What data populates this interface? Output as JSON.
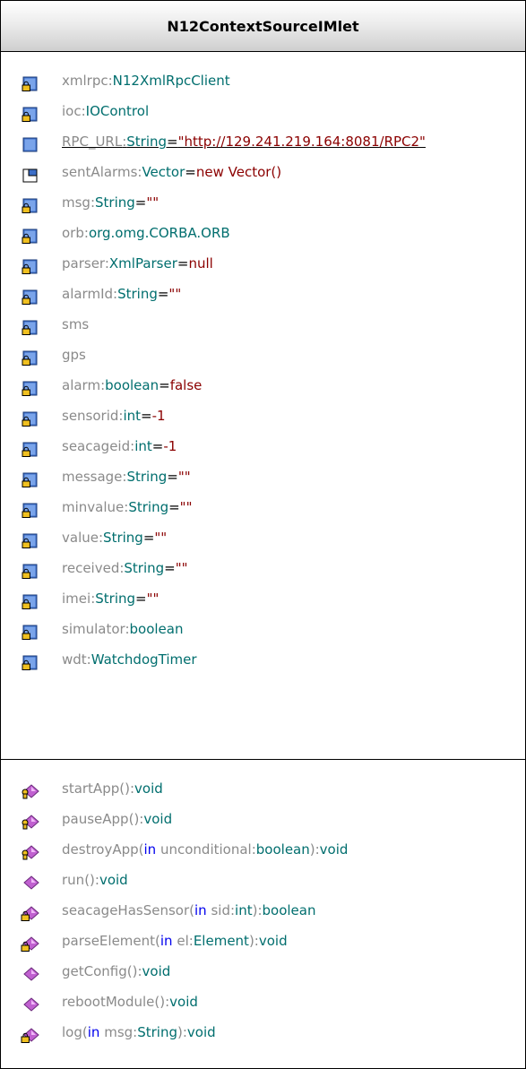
{
  "class_name": "N12ContextSourceIMlet",
  "attributes": [
    {
      "name": "xmlrpc",
      "type": "N12XmlRpcClient",
      "default": "",
      "icon": "private-attribute-icon",
      "static": false
    },
    {
      "name": "ioc",
      "type": "IOControl",
      "default": "",
      "icon": "private-attribute-icon",
      "static": false
    },
    {
      "name": "RPC_URL",
      "type": "String",
      "default": "\"http://129.241.219.164:8081/RPC2\"",
      "icon": "public-attribute-icon",
      "static": true
    },
    {
      "name": "sentAlarms",
      "type": "Vector",
      "default": "new Vector()",
      "icon": "protected-attribute-icon",
      "static": false
    },
    {
      "name": "msg",
      "type": "String",
      "default": "\"\"",
      "icon": "private-attribute-icon",
      "static": false
    },
    {
      "name": "orb",
      "type": "org.omg.CORBA.ORB",
      "default": "",
      "icon": "private-attribute-icon",
      "static": false
    },
    {
      "name": "parser",
      "type": "XmlParser",
      "default": "null",
      "icon": "private-attribute-icon",
      "static": false
    },
    {
      "name": "alarmId",
      "type": "String",
      "default": "\"\"",
      "icon": "private-attribute-icon",
      "static": false
    },
    {
      "name": "sms",
      "type": "",
      "default": "",
      "icon": "private-attribute-icon",
      "static": false
    },
    {
      "name": "gps",
      "type": "",
      "default": "",
      "icon": "private-attribute-icon",
      "static": false
    },
    {
      "name": "alarm",
      "type": "boolean",
      "default": "false",
      "icon": "private-attribute-icon",
      "static": false
    },
    {
      "name": "sensorid",
      "type": "int",
      "default": "-1",
      "icon": "private-attribute-icon",
      "static": false
    },
    {
      "name": "seacageid",
      "type": "int",
      "default": "-1",
      "icon": "private-attribute-icon",
      "static": false
    },
    {
      "name": "message",
      "type": "String",
      "default": "\"\"",
      "icon": "private-attribute-icon",
      "static": false
    },
    {
      "name": "minvalue",
      "type": "String",
      "default": "\"\"",
      "icon": "private-attribute-icon",
      "static": false
    },
    {
      "name": "value",
      "type": "String",
      "default": "\"\"",
      "icon": "private-attribute-icon",
      "static": false
    },
    {
      "name": "received",
      "type": "String",
      "default": "\"\"",
      "icon": "private-attribute-icon",
      "static": false
    },
    {
      "name": "imei",
      "type": "String",
      "default": "\"\"",
      "icon": "private-attribute-icon",
      "static": false
    },
    {
      "name": "simulator",
      "type": "boolean",
      "default": "",
      "icon": "private-attribute-icon",
      "static": false
    },
    {
      "name": "wdt",
      "type": "WatchdogTimer",
      "default": "",
      "icon": "private-attribute-icon",
      "static": false
    }
  ],
  "operations": [
    {
      "name": "startApp",
      "params": [],
      "return": "void",
      "icon": "protected-operation-icon"
    },
    {
      "name": "pauseApp",
      "params": [],
      "return": "void",
      "icon": "protected-operation-icon"
    },
    {
      "name": "destroyApp",
      "params": [
        {
          "dir": "in",
          "name": "unconditional",
          "type": "boolean"
        }
      ],
      "return": "void",
      "icon": "protected-operation-icon"
    },
    {
      "name": "run",
      "params": [],
      "return": "void",
      "icon": "public-operation-icon"
    },
    {
      "name": "seacageHasSensor",
      "params": [
        {
          "dir": "in",
          "name": "sid",
          "type": "int"
        }
      ],
      "return": "boolean",
      "icon": "private-operation-icon"
    },
    {
      "name": "parseElement",
      "params": [
        {
          "dir": "in",
          "name": "el",
          "type": "Element"
        }
      ],
      "return": "void",
      "icon": "private-operation-icon"
    },
    {
      "name": "getConfig",
      "params": [],
      "return": "void",
      "icon": "public-operation-icon"
    },
    {
      "name": "rebootModule",
      "params": [],
      "return": "void",
      "icon": "public-operation-icon"
    },
    {
      "name": "log",
      "params": [
        {
          "dir": "in",
          "name": "msg",
          "type": "String"
        }
      ],
      "return": "void",
      "icon": "private-operation-icon"
    }
  ],
  "colors": {
    "name": "#8a8a8a",
    "type": "#006e6e",
    "default": "#8b0000",
    "keyword": "#0000ee",
    "attribute_icon_blue": "#3c6ec8",
    "operation_icon_purple": "#c060d0",
    "lock_yellow": "#f0c020"
  }
}
